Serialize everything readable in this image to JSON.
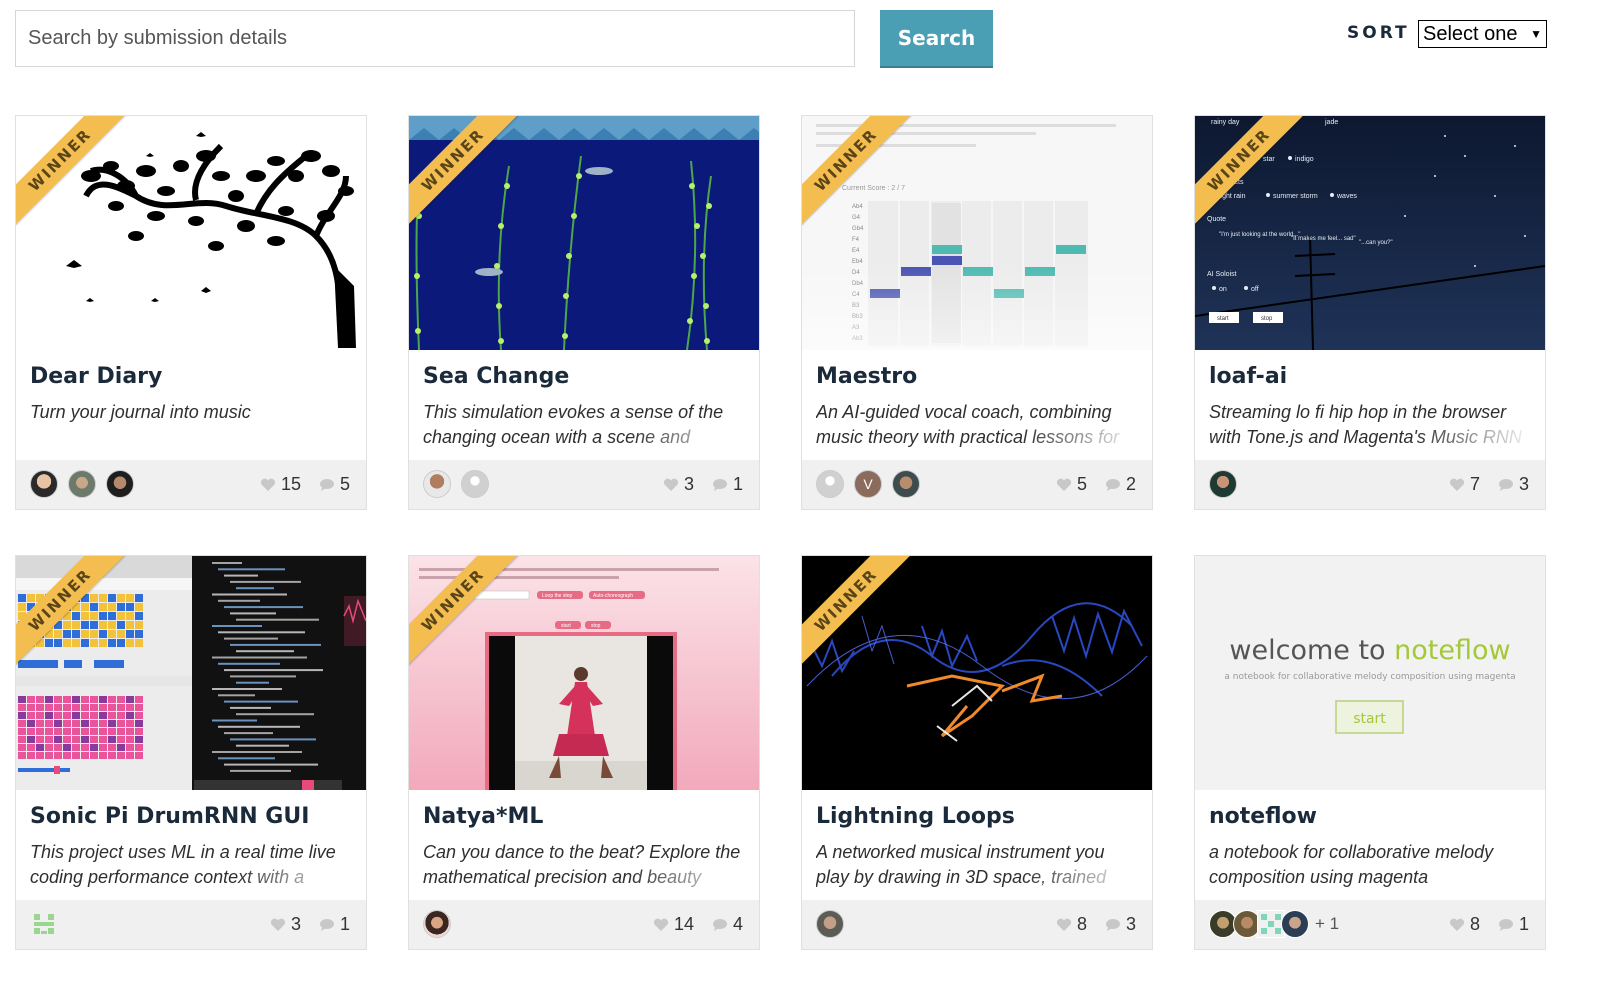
{
  "search": {
    "placeholder": "Search by submission details",
    "button_label": "Search"
  },
  "sort": {
    "label": "SORT",
    "selected": "Select one"
  },
  "ribbon_label": "WINNER",
  "colors": {
    "accent_button": "#4a9fb5",
    "ribbon": "#f3be4f",
    "title": "#1b2a3a"
  },
  "cards": [
    {
      "title": "Dear Diary",
      "description": "Turn your journal into music",
      "likes": "15",
      "comments": "5",
      "winner": true,
      "avatars": [
        "avatar-1",
        "avatar-2",
        "avatar-3"
      ]
    },
    {
      "title": "Sea Change",
      "description": "This simulation evokes a sense of the changing ocean with a scene and",
      "likes": "3",
      "comments": "1",
      "winner": true,
      "avatars": [
        "avatar-1",
        "avatar-default"
      ]
    },
    {
      "title": "Maestro",
      "description": "An AI-guided vocal coach, combining music theory with practical lessons for",
      "likes": "5",
      "comments": "2",
      "winner": true,
      "avatars": [
        "avatar-default",
        "V",
        "avatar-3"
      ]
    },
    {
      "title": "loaf-ai",
      "description": "Streaming lo fi hip hop in the browser with Tone.js and Magenta's Music RNN",
      "likes": "7",
      "comments": "3",
      "winner": true,
      "avatars": [
        "avatar-1"
      ]
    },
    {
      "title": "Sonic Pi DrumRNN GUI",
      "description": "This project uses ML in a real time live coding performance context with a",
      "likes": "3",
      "comments": "1",
      "winner": true,
      "avatars": [
        "identicon"
      ]
    },
    {
      "title": "Natya*ML",
      "description": "Can you dance to the beat? Explore the mathematical precision and beauty",
      "likes": "14",
      "comments": "4",
      "winner": true,
      "avatars": [
        "avatar-1"
      ]
    },
    {
      "title": "Lightning Loops",
      "description": "A networked musical instrument you play by drawing in 3D space, trained",
      "likes": "8",
      "comments": "3",
      "winner": true,
      "avatars": [
        "avatar-1"
      ]
    },
    {
      "title": "noteflow",
      "description": "a notebook for collaborative melody composition using magenta",
      "likes": "8",
      "comments": "1",
      "winner": false,
      "avatars": [
        "avatar-1",
        "avatar-2",
        "identicon",
        "avatar-3"
      ],
      "more": "+ 1"
    }
  ],
  "thumbs": {
    "maestro_score": "Current Score : 2 / 7",
    "maestro_notes": [
      "Ab4",
      "G4",
      "Gb4",
      "F4",
      "E4",
      "Eb4",
      "D4",
      "Db4",
      "C4",
      "B3",
      "Bb3",
      "A3",
      "Ab3"
    ],
    "loaf_labels": {
      "rainy": "rainy day",
      "jade": "jade",
      "star": "star",
      "indigo": "indigo",
      "effects": "effects",
      "light_rain": "light rain",
      "summer_storm": "summer storm",
      "waves": "waves",
      "quote": "Quote",
      "q1": "\"I'm just looking at the world...\"",
      "q2": "\"It makes me feel... sad\"",
      "q3": "\"...can you?\"",
      "soloist": "AI Soloist",
      "on": "on",
      "off": "off",
      "start": "start",
      "stop": "stop"
    },
    "natya_buttons": [
      "Loop the step",
      "Auto-choreograph",
      "start",
      "stop"
    ],
    "noteflow": {
      "welcome": "welcome to ",
      "brand": "noteflow",
      "subtitle": "a notebook for collaborative melody composition using magenta",
      "start": "start"
    }
  }
}
